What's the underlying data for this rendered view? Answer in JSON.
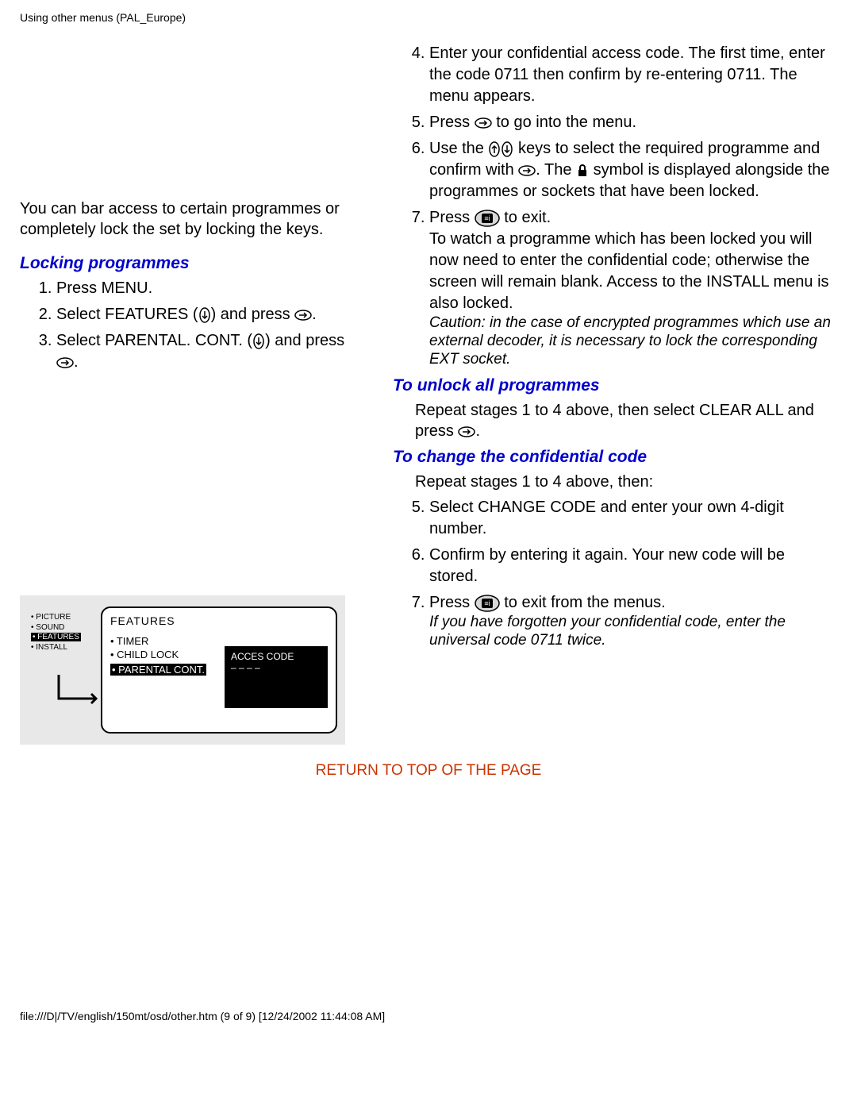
{
  "header": "Using other menus (PAL_Europe)",
  "intro": "You can bar access to certain programmes or completely lock the set by locking the keys.",
  "lockTitle": "Locking programmes",
  "lockSteps": {
    "s1": "Press MENU.",
    "s2a": "Select FEATURES (",
    "s2b": ") and press ",
    "s2c": ".",
    "s3a": "Select PARENTAL. CONT. (",
    "s3b": ") and press ",
    "s3c": ".",
    "s4": "Enter your confidential access code. The first time, enter the code 0711 then confirm by re-entering 0711. The menu appears.",
    "s5a": "Press ",
    "s5b": " to go into the menu.",
    "s6a": "Use the ",
    "s6b": " keys to select the required programme and confirm with ",
    "s6c": ". The ",
    "s6d": " symbol is displayed alongside the programmes or sockets that have been locked.",
    "s7a": "Press ",
    "s7b": " to exit.",
    "s7c": "To watch a programme which has been locked you will now need to enter the confidential code; otherwise the screen will remain blank. Access to the INSTALL menu is also locked."
  },
  "caution": "Caution: in the case of encrypted programmes which use an external decoder, it is necessary to lock the corresponding EXT socket.",
  "unlockTitle": "To unlock all programmes",
  "unlockPara_a": "Repeat stages 1 to 4 above, then select CLEAR ALL and press ",
  "unlockPara_b": ".",
  "changeTitle": "To change the confidential code",
  "changeIntro": "Repeat stages 1 to 4 above, then:",
  "changeSteps": {
    "s5": "Select CHANGE CODE and enter your own 4-digit number.",
    "s6": "Confirm by entering it again. Your new code will be stored.",
    "s7a": "Press ",
    "s7b": " to exit from the menus."
  },
  "changeNote": "If you have forgotten your confidential code, enter the universal code 0711 twice.",
  "returnLink": "RETURN TO TOP OF THE PAGE",
  "footer": "file:///D|/TV/english/150mt/osd/other.htm (9 of 9) [12/24/2002 11:44:08 AM]",
  "tvMenu": {
    "sidebar": [
      "• PICTURE",
      "• SOUND",
      "• FEATURES",
      "• INSTALL"
    ],
    "sidebarSelectedIndex": 2,
    "mainTitle": "FEATURES",
    "items": [
      "• TIMER",
      "• CHILD LOCK",
      "• PARENTAL CONT."
    ],
    "itemsSelectedIndex": 2,
    "popupTitle": "ACCES CODE",
    "popupValue": "– – – –"
  }
}
